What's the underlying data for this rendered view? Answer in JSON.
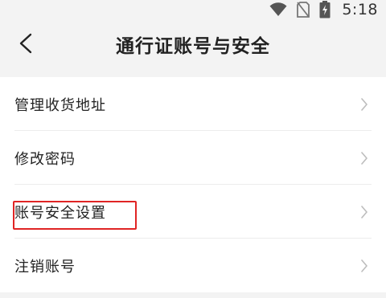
{
  "status_bar": {
    "time": "5:18",
    "icons": [
      "wifi-icon",
      "no-sim-icon",
      "battery-charging-icon"
    ]
  },
  "header": {
    "back_icon": "chevron-left-icon",
    "title": "通行证账号与安全"
  },
  "list": {
    "items": [
      {
        "label": "管理收货地址",
        "icon": "chevron-right-icon"
      },
      {
        "label": "修改密码",
        "icon": "chevron-right-icon"
      },
      {
        "label": "账号安全设置",
        "icon": "chevron-right-icon",
        "highlighted": true
      },
      {
        "label": "注销账号",
        "icon": "chevron-right-icon"
      }
    ]
  },
  "colors": {
    "background": "#f3f3f3",
    "list_background": "#ffffff",
    "highlight": "#e02424",
    "text": "#222222",
    "chevron": "#bdbdbd"
  }
}
